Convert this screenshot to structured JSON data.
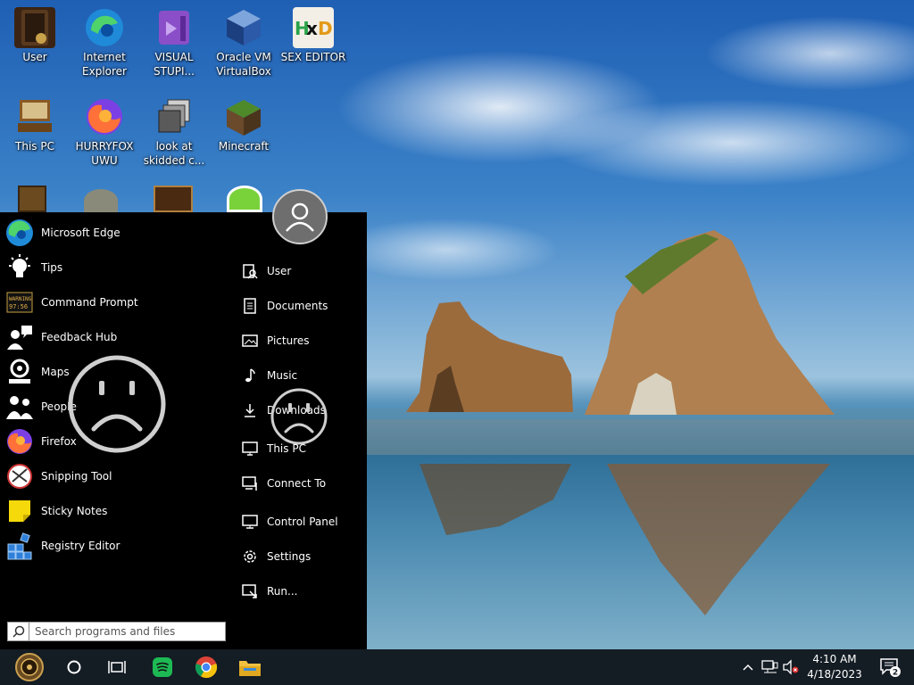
{
  "desktop": {
    "icons": [
      {
        "name": "user",
        "label": "User"
      },
      {
        "name": "internet-explorer",
        "label": "Internet Explorer"
      },
      {
        "name": "visual-stupio",
        "label": "VISUAL STUPI..."
      },
      {
        "name": "oracle-vm-virtualbox",
        "label": "Oracle VM VirtualBox"
      },
      {
        "name": "sex-editor",
        "label": "SEX EDITOR"
      },
      {
        "name": "this-pc",
        "label": "This PC"
      },
      {
        "name": "hurryfox-uwu",
        "label": "HURRYFOX UWU"
      },
      {
        "name": "look-at-skidded",
        "label": "look at skidded c..."
      },
      {
        "name": "minecraft",
        "label": "Minecraft"
      }
    ]
  },
  "start_menu": {
    "apps": [
      {
        "label": "Microsoft Edge",
        "icon": "edge-icon"
      },
      {
        "label": "Tips",
        "icon": "lightbulb-icon"
      },
      {
        "label": "Command Prompt",
        "icon": "command-prompt-icon"
      },
      {
        "label": "Feedback Hub",
        "icon": "feedback-hub-icon"
      },
      {
        "label": "Maps",
        "icon": "maps-icon"
      },
      {
        "label": "People",
        "icon": "people-icon"
      },
      {
        "label": "Firefox",
        "icon": "firefox-icon"
      },
      {
        "label": "Snipping Tool",
        "icon": "snipping-tool-icon"
      },
      {
        "label": "Sticky Notes",
        "icon": "sticky-notes-icon"
      },
      {
        "label": "Registry Editor",
        "icon": "registry-editor-icon"
      }
    ],
    "places": [
      {
        "label": "User",
        "icon": "user-folder-icon"
      },
      {
        "label": "Documents",
        "icon": "document-icon"
      },
      {
        "label": "Pictures",
        "icon": "picture-icon"
      },
      {
        "label": "Music",
        "icon": "music-note-icon"
      },
      {
        "label": "Downloads",
        "icon": "download-icon"
      },
      {
        "label": "This PC",
        "icon": "computer-icon"
      },
      {
        "label": "Connect To",
        "icon": "connect-icon"
      },
      {
        "label": "Control Panel",
        "icon": "control-panel-icon"
      },
      {
        "label": "Settings",
        "icon": "gear-icon"
      },
      {
        "label": "Run...",
        "icon": "run-icon"
      }
    ],
    "command_prompt_icon_text": [
      "WARNING",
      "97:56"
    ],
    "search": {
      "placeholder": "Search programs and files"
    }
  },
  "taskbar": {
    "pinned": [
      "start-orb",
      "cortana-circle",
      "task-view",
      "spotify",
      "chrome",
      "file-explorer"
    ],
    "clock": {
      "time": "4:10 AM",
      "date": "4/18/2023"
    },
    "notification_count": "2",
    "accent": "#1db954",
    "background": "#141c24"
  },
  "colors": {
    "start_menu_bg": "#000000",
    "edge_blue": "#1f8ad8",
    "firefox_orange": "#ff7139",
    "sticky_yellow": "#f5d90a"
  }
}
